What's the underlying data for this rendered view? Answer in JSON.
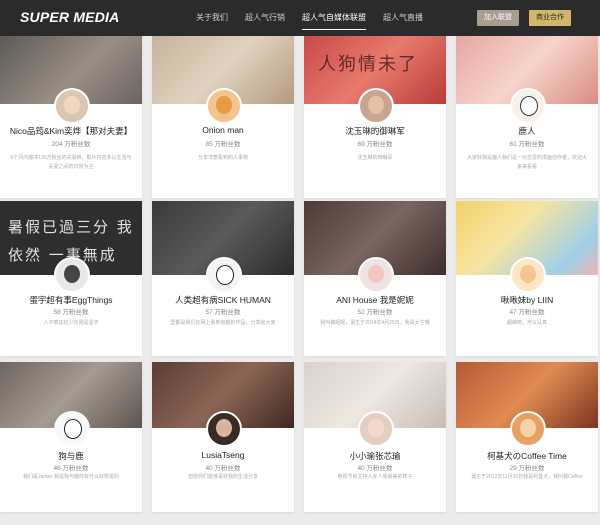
{
  "header": {
    "logo": "SUPER MEDIA",
    "nav": [
      "关于我们",
      "超人气行销",
      "超人气自媒体联盟",
      "超人气直播"
    ],
    "active_index": 2,
    "join_label": "加入联盟",
    "business_label": "商业合作"
  },
  "colors": {
    "topbar": "#2b2b2b",
    "join_button": "#a89e8f",
    "business_button": "#d4b66a"
  },
  "cards": [
    {
      "name": "Nico品筠&Kim奕烨【那对夫妻】",
      "fans": "204 万粉丝数",
      "desc": "6个月内爆冲130万粉丝的夫妻档，影片内容多以生活与夫妻之间的日常为主"
    },
    {
      "name": "Onion man",
      "fans": "85 万粉丝数",
      "desc": "分享洋葱看到的人事物"
    },
    {
      "name": "沈玉琳的御琳军",
      "fans": "69 万粉丝数",
      "desc": "沈玉琳的御琳军"
    },
    {
      "name": "鹿人",
      "fans": "61 万粉丝数",
      "desc": "大家好我是鹿人我们是一对恋爱的漫画创作者，欢迎大家来看看"
    },
    {
      "name": "蛋宇超有事EggThings",
      "fans": "58 万粉丝数",
      "desc": "人不疯狂枉少年我是蛋宇"
    },
    {
      "name": "人类超有病SICK HUMAN",
      "fans": "57 万粉丝数",
      "desc": "里都是我们在网上看到有趣的作品，分享给大家"
    },
    {
      "name": "ANI House 我是妮妮",
      "fans": "52 万粉丝数",
      "desc": "我叫做妮妮，诞生于2014年4月25日，我是女生哦"
    },
    {
      "name": "啾啾妹by LIIN",
      "fans": "47 万粉丝数",
      "desc": "超萌吧，可以认真"
    },
    {
      "name": "狗与鹿",
      "fans": "46 万粉丝数",
      "desc": "我们是James 我是狗与鹿你有什么好想说的"
    },
    {
      "name": "LusiaTseng",
      "fans": "40 万粉丝数",
      "desc": "但愿你们能够喜欢我的生活分享"
    },
    {
      "name": "小小瑜张芯瑜",
      "fans": "40 万粉丝数",
      "desc": "电视节目主持人女人我最美的样子"
    },
    {
      "name": "柯基犬のCoffee Time",
      "fans": "29 万粉丝数",
      "desc": "诞生于2012年11月20日我是柯基犬，我叫做Coffee"
    }
  ],
  "cover_texts": [
    "",
    "",
    "人狗情未了",
    "",
    "暑假已過三分 我依然 一事無成",
    "",
    "",
    "",
    "",
    "",
    "",
    ""
  ]
}
